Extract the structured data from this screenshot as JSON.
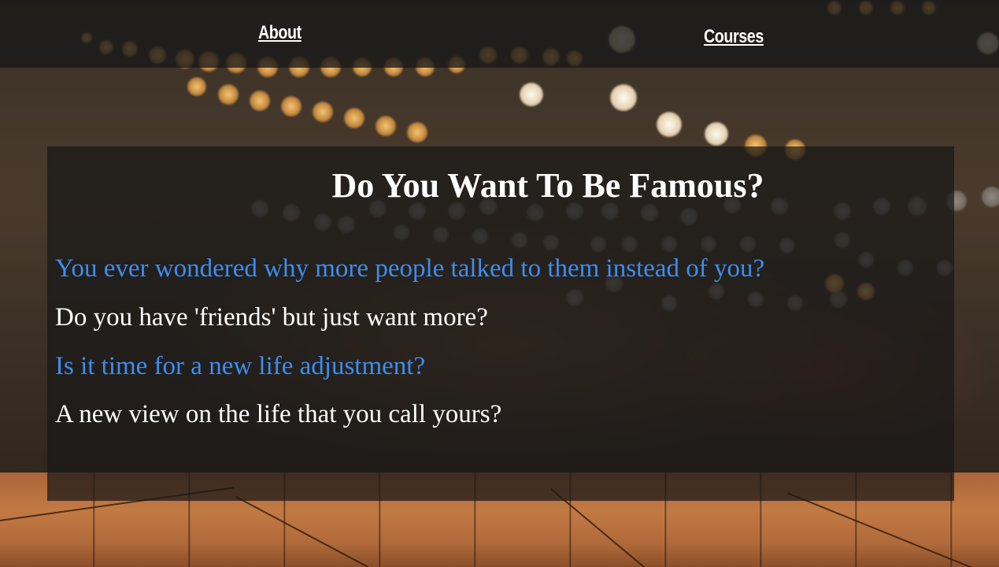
{
  "nav": {
    "about_label": "About",
    "courses_label": "Courses"
  },
  "hero": {
    "title": "Do You Want To Be Famous?",
    "lines": [
      {
        "text": "You ever wondered why more people talked to them instead of you?",
        "color": "#3b8ef0"
      },
      {
        "text": "Do you have 'friends' but just want more?",
        "color": "#ffffff"
      },
      {
        "text": "Is it time for a new life adjustment?",
        "color": "#3b8ef0"
      },
      {
        "text": "A new view on the life that you call yours?",
        "color": "#ffffff"
      }
    ]
  },
  "colors": {
    "accent_blue": "#3b8ef0",
    "text_white": "#ffffff",
    "overlay_dark": "#181818"
  }
}
